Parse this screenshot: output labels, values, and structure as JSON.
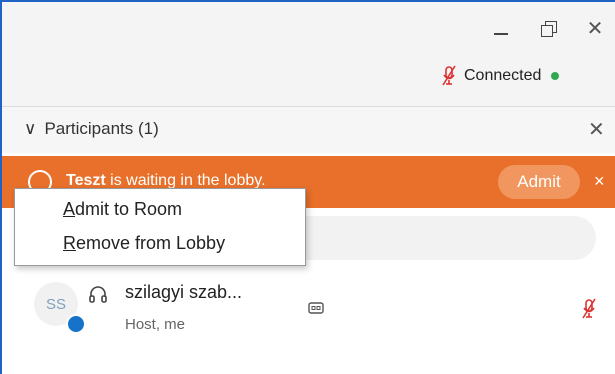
{
  "window": {
    "minimize_icon": "minimize-icon",
    "restore_icon": "restore-icon",
    "close_icon": "close-icon",
    "close_glyph": "✕"
  },
  "status": {
    "mic_icon": "mic-muted-icon",
    "label": "Connected",
    "dot_color": "#2fa84f"
  },
  "panel": {
    "chevron_glyph": "∨",
    "title": "Participants (1)",
    "close_glyph": "✕"
  },
  "lobby": {
    "name": "Teszt",
    "message": " is waiting in the lobby.",
    "admit_label": "Admit",
    "close_glyph": "×",
    "color": "#e8702a"
  },
  "context_menu": {
    "admit_accel": "A",
    "admit_rest": "dmit to Room",
    "remove_accel": "R",
    "remove_rest": "emove from Lobby"
  },
  "participant": {
    "initials": "SS",
    "name": "szilagyi szab...",
    "role": "Host, me"
  }
}
